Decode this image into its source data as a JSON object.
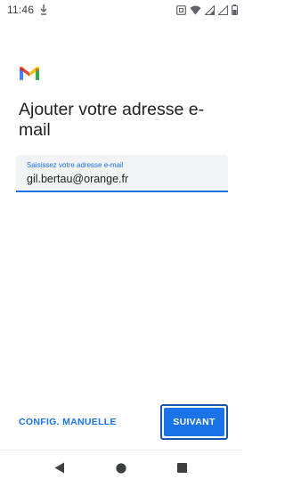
{
  "status_bar": {
    "time": "11:46",
    "icons": [
      "download-icon",
      "nfc-icon",
      "wifi-icon",
      "signal-icon",
      "signal-icon-2",
      "battery-icon"
    ]
  },
  "app": {
    "logo": "gmail-logo"
  },
  "page": {
    "title": "Ajouter votre adresse e-mail"
  },
  "email_field": {
    "label": "Saisissez votre adresse e-mail",
    "value": "gil.bertau@orange.fr"
  },
  "actions": {
    "manual_config_label": "CONFIG. MANUELLE",
    "next_label": "SUIVANT"
  },
  "navigation": {
    "icons": [
      "back-icon",
      "home-icon",
      "recents-icon"
    ]
  },
  "colors": {
    "accent": "#1a73e8",
    "field_bg": "#f1f3f4",
    "text": "#202124"
  }
}
